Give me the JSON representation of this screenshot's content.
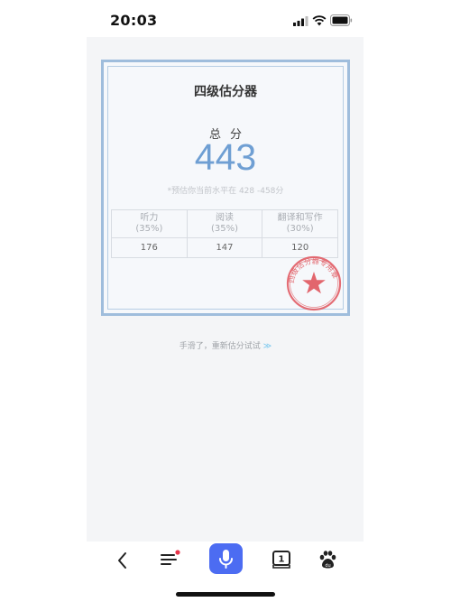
{
  "status_bar": {
    "time": "20:03"
  },
  "card": {
    "title": "四级估分器",
    "total_label": "总分",
    "total_score": "443",
    "estimate_text": "*预估你当前水平在 428 -458分",
    "table": {
      "headers": [
        {
          "name": "听力",
          "weight": "(35%)"
        },
        {
          "name": "阅读",
          "weight": "(35%)"
        },
        {
          "name": "翻译和写作",
          "weight": "(30%)"
        }
      ],
      "values": [
        "176",
        "147",
        "120"
      ]
    },
    "stamp_text": "四级估分器专用章"
  },
  "retry": {
    "label": "手滑了，重新估分试试",
    "arrows": "≫"
  },
  "colors": {
    "accent": "#6f9fd3",
    "stamp": "#e0555d",
    "mic": "#4c6cf2",
    "card_border": "#9fbddc"
  }
}
